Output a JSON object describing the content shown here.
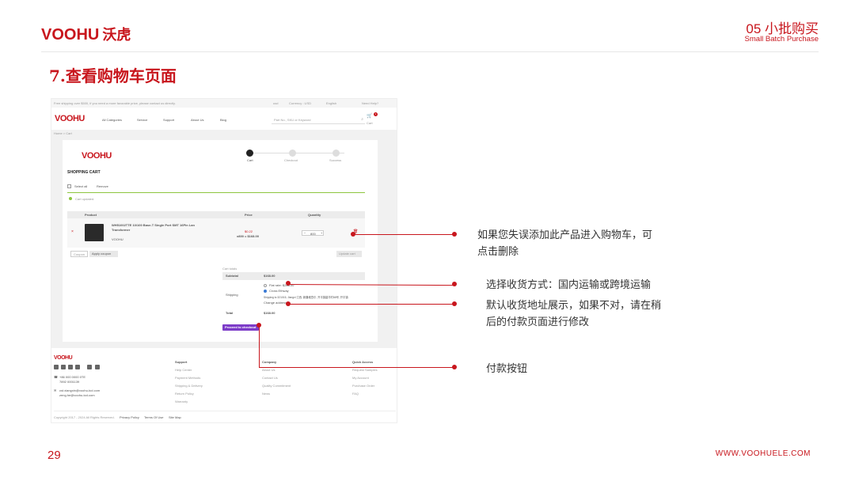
{
  "header": {
    "logo": "VOOHU",
    "logo_cn": "沃虎",
    "section_number_title": "05 小批购买",
    "section_subtitle": "Small Batch Purchase"
  },
  "slide": {
    "title": "7.查看购物车页面",
    "page_number": "29",
    "website": "WWW.VOOHUELE.COM"
  },
  "screenshot": {
    "topbar": {
      "promo": "Free shipping over $500, if you need a more favorable price, please contact us directly.",
      "currency_label": "usd",
      "currency": "Currency : USD",
      "language": "English",
      "help": "Need Help?"
    },
    "nav": {
      "logo": "VOOHU",
      "items": [
        "All Categories",
        "Service",
        "Support",
        "About Us",
        "Blog"
      ],
      "search_placeholder": "Part No., SKU or Keyword",
      "cart_label": "Cart",
      "cart_count": "1"
    },
    "breadcrumb": "Home > Cart",
    "card": {
      "logo": "VOOHU",
      "steps": [
        {
          "num": "1",
          "label": "Cart"
        },
        {
          "num": "2",
          "label": "Checkout"
        },
        {
          "num": "3",
          "label": "Success"
        }
      ],
      "title": "SHOPPING CART",
      "select_all": "Select all",
      "remove": "Remove",
      "notice": "Cart updated.",
      "columns": {
        "product": "Product",
        "price": "Price",
        "quantity": "Quantity"
      },
      "item": {
        "remove_mark": "×",
        "name_line1": "WH51002TTE 10/100 Base-T Single Port SMT 16Pin Lan",
        "name_line2": "Transformer",
        "brand": "VOOHU",
        "price": "$0.22",
        "price_calc": "x800 = $168.00",
        "qty": "800"
      },
      "coupon_placeholder": "Coupon",
      "apply_coupon": "Apply coupon",
      "update_cart": "Update cart",
      "totals": {
        "heading": "Cart totals",
        "subtotal_label": "Subtotal",
        "subtotal_value": "$168.00",
        "shipping_label": "Shipping",
        "option1": "Flat rate: $288.00",
        "option2": "Cross Ethway",
        "address": "Shipping to 321015, Jiangxi 江西, 新疆维吾尔, 开平镇碧华村68号, 开平镇",
        "change_address": "Change address",
        "total_label": "Total",
        "total_value": "$168.00",
        "checkout_button": "Proceed to checkout"
      }
    },
    "footer": {
      "logo": "VOOHU",
      "phone1": "+86 000 0000 0TE",
      "phone2": "7892 0001139",
      "email1": "cst.xiangxin@voohu-tcd.com",
      "email2": "zeng.he@voohu-tcd.com",
      "columns": [
        {
          "title": "Support",
          "links": [
            "Help Center",
            "Payment Methods",
            "Shipping & Delivery",
            "Return Policy",
            "Warranty"
          ]
        },
        {
          "title": "Company",
          "links": [
            "About Us",
            "Contact Us",
            "Quality Commitment",
            "News"
          ]
        },
        {
          "title": "Quick Access",
          "links": [
            "Request Samples",
            "My Account",
            "Purchase Order",
            "FAQ"
          ]
        }
      ],
      "copyright": "Copyright 2017 - 2024 All Rights Reserved.",
      "links": [
        "Privacy Policy",
        "Terms Of Use",
        "Site Map"
      ]
    }
  },
  "annotations": {
    "delete_note": [
      "如果您失误添加此产品进入购物车，可",
      "点击删除"
    ],
    "shipping_note": "选择收货方式：国内运输或跨境运输",
    "address_note": [
      "默认收货地址展示，如果不对，请在稍",
      "后的付款页面进行修改"
    ],
    "checkout_note": "付款按钮"
  },
  "colors": {
    "accent": "#c8161d",
    "checkout_button": "#7d3cc8",
    "success_line": "#8dc63f"
  }
}
